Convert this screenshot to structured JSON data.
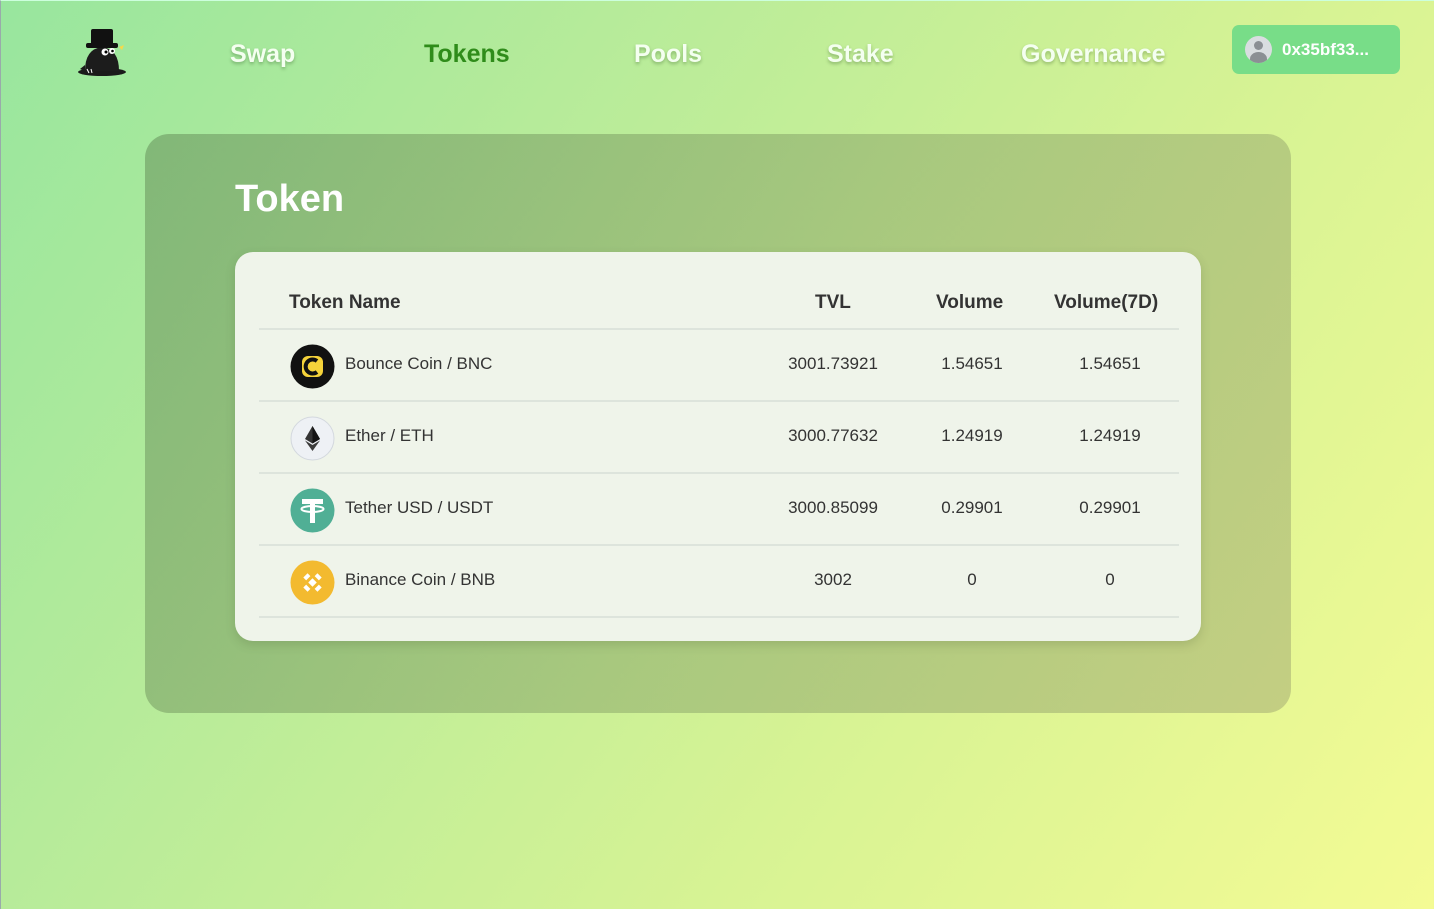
{
  "nav": {
    "logo": "mole-hat-logo",
    "items": [
      {
        "label": "Swap",
        "active": false
      },
      {
        "label": "Tokens",
        "active": true
      },
      {
        "label": "Pools",
        "active": false
      },
      {
        "label": "Stake",
        "active": false
      },
      {
        "label": "Governance",
        "active": false
      }
    ],
    "wallet": {
      "address": "0x35bf33...",
      "icon": "user-avatar-icon",
      "color": "#78dd88"
    }
  },
  "page": {
    "title": "Token",
    "table": {
      "headers": {
        "name": "Token Name",
        "tvl": "TVL",
        "volume": "Volume",
        "volume7d": "Volume(7D)"
      },
      "rows": [
        {
          "name": "Bounce Coin / BNC",
          "icon": "bounce-coin-icon",
          "tvl": "3001.73921",
          "volume": "1.54651",
          "volume7d": "1.54651"
        },
        {
          "name": "Ether / ETH",
          "icon": "ethereum-icon",
          "tvl": "3000.77632",
          "volume": "1.24919",
          "volume7d": "1.24919"
        },
        {
          "name": "Tether USD / USDT",
          "icon": "tether-icon",
          "tvl": "3000.85099",
          "volume": "0.29901",
          "volume7d": "0.29901"
        },
        {
          "name": "Binance Coin / BNB",
          "icon": "binance-icon",
          "tvl": "3002",
          "volume": "0",
          "volume7d": "0"
        }
      ]
    }
  },
  "colors": {
    "active_nav": "#2f8c1a",
    "tether": "#50af95",
    "binance": "#f3ba2f",
    "bounce_yellow": "#f5d33a"
  }
}
